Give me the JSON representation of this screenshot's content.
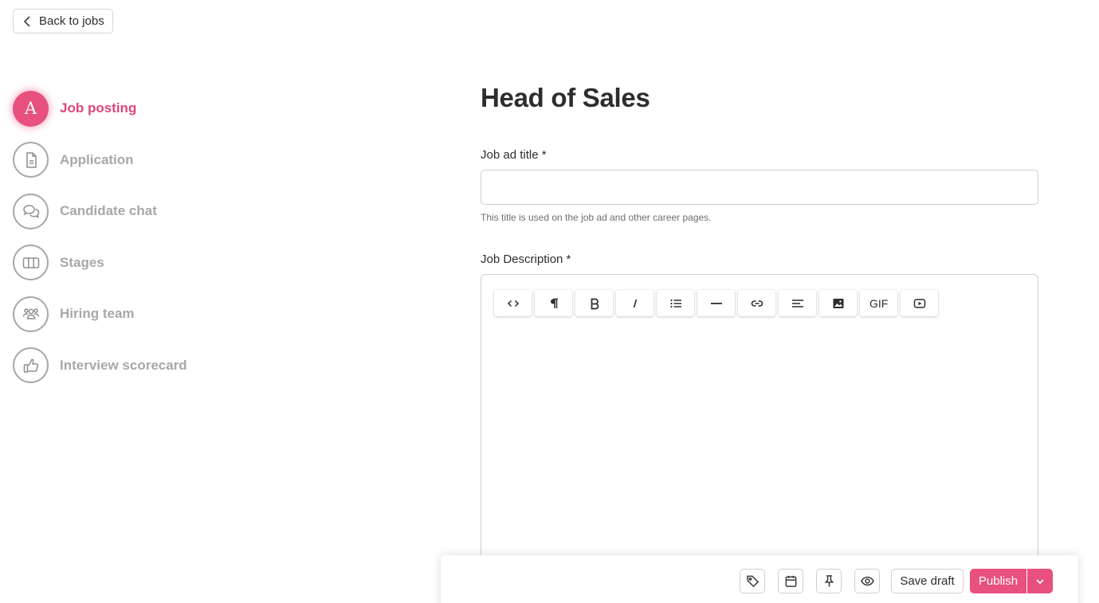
{
  "header": {
    "back_label": "Back to jobs"
  },
  "steps": [
    {
      "label": "Job posting",
      "icon": "letter-a-icon",
      "letter": "A",
      "active": true
    },
    {
      "label": "Application",
      "icon": "document-icon",
      "active": false
    },
    {
      "label": "Candidate chat",
      "icon": "chat-bubbles-icon",
      "active": false
    },
    {
      "label": "Stages",
      "icon": "columns-icon",
      "active": false
    },
    {
      "label": "Hiring team",
      "icon": "team-icon",
      "active": false
    },
    {
      "label": "Interview scorecard",
      "icon": "thumbs-up-icon",
      "active": false
    }
  ],
  "main": {
    "title": "Head of Sales",
    "job_ad_title": {
      "label": "Job ad title *",
      "value": "",
      "help": "This title is used on the job ad and other career pages."
    },
    "description": {
      "label": "Job Description *",
      "toolbar": [
        {
          "name": "code-icon"
        },
        {
          "name": "paragraph-icon"
        },
        {
          "name": "bold-icon"
        },
        {
          "name": "italic-icon"
        },
        {
          "name": "bullet-list-icon"
        },
        {
          "name": "horizontal-rule-icon"
        },
        {
          "name": "link-icon"
        },
        {
          "name": "align-icon"
        },
        {
          "name": "image-icon"
        },
        {
          "name": "gif-button",
          "text": "GIF"
        },
        {
          "name": "video-icon"
        }
      ]
    }
  },
  "footer": {
    "icons": [
      "tag-icon",
      "calendar-icon",
      "pin-icon",
      "eye-icon"
    ],
    "save_draft_label": "Save draft",
    "publish_label": "Publish"
  },
  "colors": {
    "accent": "#e8507e",
    "accent_text": "#e0447a",
    "muted": "#a8a8a8"
  }
}
